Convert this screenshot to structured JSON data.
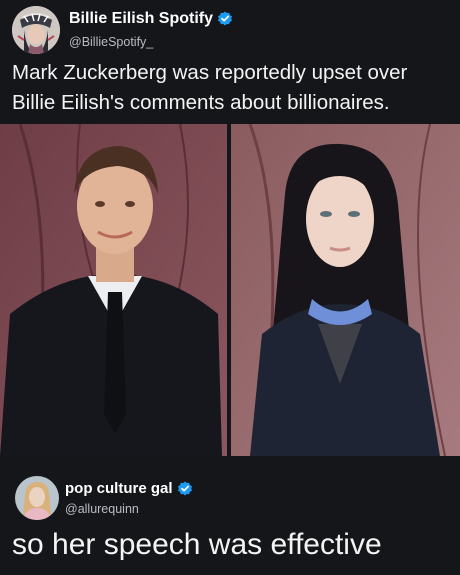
{
  "post": {
    "author_name": "Billie Eilish Spotify",
    "author_handle": "@BillieSpotify_",
    "text": "Mark Zuckerberg was reportedly upset over Billie Eilish's comments about billionaires.",
    "verified_icon": "verified-check-icon",
    "accent_color": "#1d9bf0"
  },
  "reply": {
    "author_name": "pop culture gal",
    "author_handle": "@allurequinn",
    "text": "so her speech was effective",
    "verified_icon": "verified-check-icon"
  }
}
